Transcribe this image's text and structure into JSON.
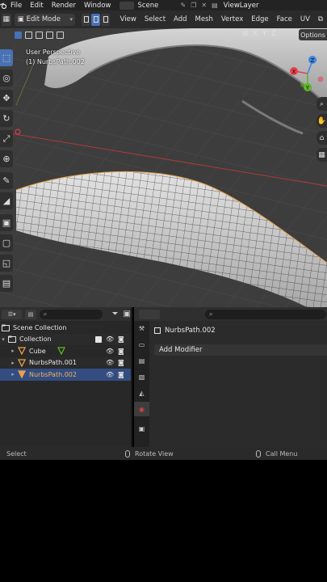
{
  "topbar": {
    "menus": [
      "File",
      "Edit",
      "Render",
      "Window"
    ],
    "scene": "Scene",
    "view_layer": "ViewLayer"
  },
  "viewport_header": {
    "mode": "Edit Mode",
    "menus": [
      "View",
      "Select",
      "Add",
      "Mesh",
      "Vertex",
      "Edge",
      "Face",
      "UV"
    ]
  },
  "viewport": {
    "perspective": "User Perspective",
    "object_label": "(1) NurbsPath.002",
    "axes": [
      "X",
      "Y",
      "Z"
    ],
    "options": "Options"
  },
  "gizmo": {
    "x": "X",
    "y": "Y",
    "z": "Z"
  },
  "outliner": {
    "search_placeholder": "",
    "items": [
      {
        "label": "Scene Collection"
      },
      {
        "label": "Collection"
      },
      {
        "label": "Cube"
      },
      {
        "label": "NurbsPath.001"
      },
      {
        "label": "NurbsPath.002"
      }
    ]
  },
  "properties": {
    "object_name": "NurbsPath.002",
    "add_modifier": "Add Modifier"
  },
  "statusbar": {
    "select": "Select",
    "rotate_view": "Rotate View",
    "call_menu": "Call Menu"
  },
  "colors": {
    "accent": "#4772b3",
    "selected_row": "#334d80",
    "object_orange": "#e8a04a",
    "axis_x": "#e8414f",
    "axis_y": "#5fb52a",
    "axis_z": "#3f86e0"
  }
}
